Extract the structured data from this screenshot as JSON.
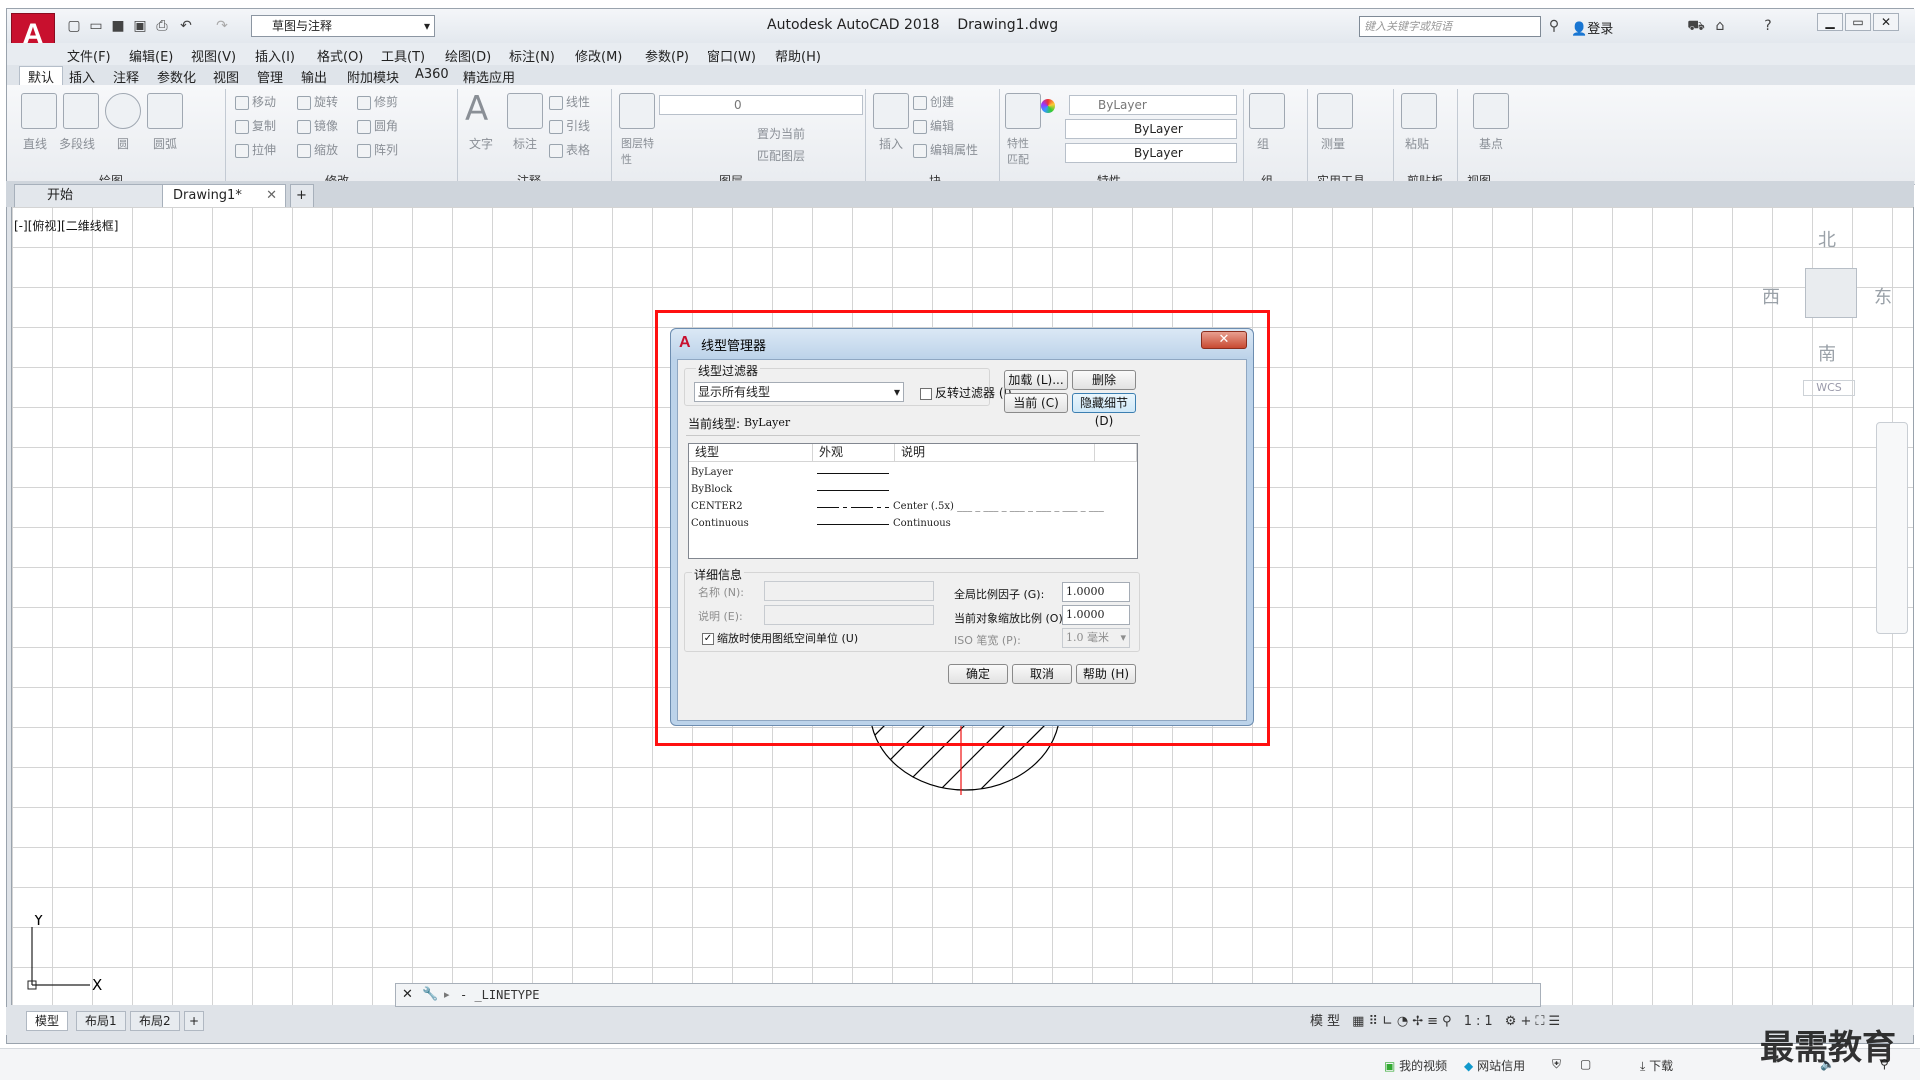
{
  "app": {
    "title": "Autodesk AutoCAD 2018",
    "file": "Drawing1.dwg",
    "workspace": "草图与注释",
    "search_placeholder": "键入关键字或短语",
    "login": "登录"
  },
  "menu": [
    "文件(F)",
    "编辑(E)",
    "视图(V)",
    "插入(I)",
    "格式(O)",
    "工具(T)",
    "绘图(D)",
    "标注(N)",
    "修改(M)",
    "参数(P)",
    "窗口(W)",
    "帮助(H)"
  ],
  "ribbon_tabs": [
    "默认",
    "插入",
    "注释",
    "参数化",
    "视图",
    "管理",
    "输出",
    "附加模块",
    "A360",
    "精选应用"
  ],
  "ribbon": {
    "panels": [
      "绘图",
      "修改",
      "注释",
      "图层",
      "块",
      "特性",
      "组",
      "实用工具",
      "剪贴板",
      "视图"
    ],
    "draw_tools": [
      "直线",
      "多段线",
      "圆",
      "圆弧"
    ],
    "modify_tools": [
      "移动",
      "旋转",
      "修剪",
      "复制",
      "镜像",
      "圆角",
      "拉伸",
      "缩放",
      "阵列"
    ],
    "annotate_tools": [
      "文字",
      "标注",
      "线性",
      "引线",
      "表格"
    ],
    "layer_tools": [
      "图层特性",
      "置为当前",
      "匹配图层"
    ],
    "layer_current": "0",
    "block_tools": [
      "插入",
      "创建",
      "编辑",
      "编辑属性"
    ],
    "properties": {
      "match": "特性匹配",
      "color": "ByLayer",
      "linetype": "ByLayer",
      "lineweight": "ByLayer"
    },
    "group_tools": [
      "组"
    ],
    "util_tools": [
      "测量"
    ],
    "clipboard_tools": [
      "粘贴"
    ],
    "view_tools": [
      "基点"
    ]
  },
  "doc_tabs": [
    "开始",
    "Drawing1*"
  ],
  "viewport_label": "[-][俯视][二维线框]",
  "compass": {
    "n": "北",
    "s": "南",
    "e": "东",
    "w": "西",
    "wcs": "WCS"
  },
  "ucs": {
    "x": "X",
    "y": "Y"
  },
  "command_line": "- _LINETYPE",
  "layout_tabs": [
    "模型",
    "布局1",
    "布局2"
  ],
  "status": {
    "model": "模型",
    "scale": "1:1"
  },
  "dialog": {
    "title": "线型管理器",
    "filter_label": "线型过滤器",
    "filter_value": "显示所有线型",
    "invert_filter": "反转过滤器 (I)",
    "btn_load": "加载 (L)...",
    "btn_delete": "删除",
    "btn_current": "当前 (C)",
    "btn_hide": "隐藏细节 (D)",
    "current_linetype_label": "当前线型:",
    "current_linetype_value": "ByLayer",
    "columns": [
      "线型",
      "外观",
      "说明"
    ],
    "rows": [
      {
        "name": "ByLayer",
        "desc": ""
      },
      {
        "name": "ByBlock",
        "desc": ""
      },
      {
        "name": "CENTER2",
        "desc": "Center (.5x) ___ _ ___ _ ___ _ ___ _ ___ _ ___"
      },
      {
        "name": "Continuous",
        "desc": "Continuous"
      }
    ],
    "details_label": "详细信息",
    "name_label": "名称 (N):",
    "desc_label": "说明 (E):",
    "paper_units": "缩放时使用图纸空间单位 (U)",
    "global_scale_label": "全局比例因子 (G):",
    "global_scale_value": "1.0000",
    "current_scale_label": "当前对象缩放比例 (O):",
    "current_scale_value": "1.0000",
    "iso_label": "ISO 笔宽 (P):",
    "iso_value": "1.0 毫米",
    "btn_ok": "确定",
    "btn_cancel": "取消",
    "btn_help": "帮助 (H)"
  },
  "taskbar": [
    "我的视频",
    "网站信用",
    "下载"
  ],
  "watermark": "最需教育"
}
